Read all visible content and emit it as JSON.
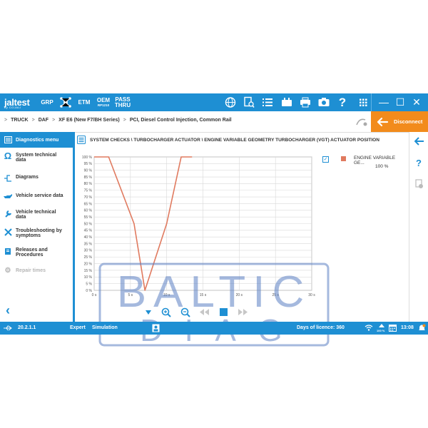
{
  "topbar": {
    "logo_text": "jaltest",
    "logo_subtext": "by COJALI",
    "btn_grp": "GRP",
    "btn_etm": "ETM",
    "btn_oem_line1": "OEM",
    "btn_oem_line2": "RP1210",
    "btn_pass_line1": "PASS",
    "btn_pass_line2": "THRU",
    "icons": [
      "globe-icon",
      "document-search-icon",
      "list-icon",
      "ecu-icon",
      "print-icon",
      "camera-icon",
      "help-icon",
      "apps-grid-icon"
    ]
  },
  "window": {
    "minimize": "—",
    "maximize": "☐",
    "close": "✕"
  },
  "breadcrumb": {
    "items": [
      "TRUCK",
      "DAF",
      "XF E6 (New F7/BH Series)",
      "PCI, Diesel Control Injection, Common Rail"
    ],
    "separator": ">"
  },
  "disconnect_label": "Disconnect",
  "sidebar": {
    "items": [
      {
        "label": "Diagnostics menu",
        "icon": "list-icon"
      },
      {
        "label": "System technical data",
        "icon": "ohm-icon"
      },
      {
        "label": "Diagrams",
        "icon": "diagram-icon"
      },
      {
        "label": "Vehicle service data",
        "icon": "oil-can-icon"
      },
      {
        "label": "Vehicle technical data",
        "icon": "wrench-icon"
      },
      {
        "label": "Troubleshooting by symptoms",
        "icon": "tools-icon"
      },
      {
        "label": "Releases and Procedures",
        "icon": "book-icon"
      },
      {
        "label": "Repair times",
        "icon": "gear-icon"
      }
    ],
    "back": "‹"
  },
  "content": {
    "title": "SYSTEM CHECKS \\ TURBOCHARGER ACTUATOR \\ ENGINE VARIABLE GEOMETRY TURBOCHARGER (VGT) ACTUATOR POSITION"
  },
  "legend": {
    "label": "ENGINE VARIABLE GE...",
    "value": "100 %",
    "color": "#e07a5f"
  },
  "chart_data": {
    "type": "line",
    "x": [
      0,
      1,
      2,
      5.5,
      7,
      10,
      12,
      13.5
    ],
    "series": [
      {
        "values": [
          100,
          100,
          100,
          50,
          0,
          50,
          100,
          100
        ]
      }
    ],
    "xlabel": "",
    "ylabel": "",
    "xlim": [
      0,
      30
    ],
    "ylim": [
      0,
      100
    ],
    "xticks": [
      "0 s",
      "5 s",
      "10 s",
      "15 s",
      "20 s",
      "25 s",
      "30 s"
    ],
    "yticks": [
      "0 %",
      "5 %",
      "10 %",
      "15 %",
      "20 %",
      "25 %",
      "30 %",
      "35 %",
      "40 %",
      "45 %",
      "50 %",
      "55 %",
      "60 %",
      "65 %",
      "70 %",
      "75 %",
      "80 %",
      "85 %",
      "90 %",
      "95 %",
      "100 %"
    ],
    "grid": true,
    "line_color": "#e07a5f"
  },
  "chart_controls": [
    "chevron-down-icon",
    "zoom-in-icon",
    "zoom-out-icon",
    "rewind-icon",
    "stop-icon",
    "fast-forward-icon"
  ],
  "watermark": {
    "line1": "BALTIC",
    "line2": "D·I·A·G"
  },
  "status": {
    "version": "20.2.1.1",
    "mode1": "Expert",
    "mode2": "Simulation",
    "licence": "Days of licence: 360",
    "battery": "100 %",
    "time": "13:08"
  },
  "colors": {
    "primary": "#1e8fd3",
    "accent": "#f28b1c",
    "series": "#e07a5f"
  }
}
